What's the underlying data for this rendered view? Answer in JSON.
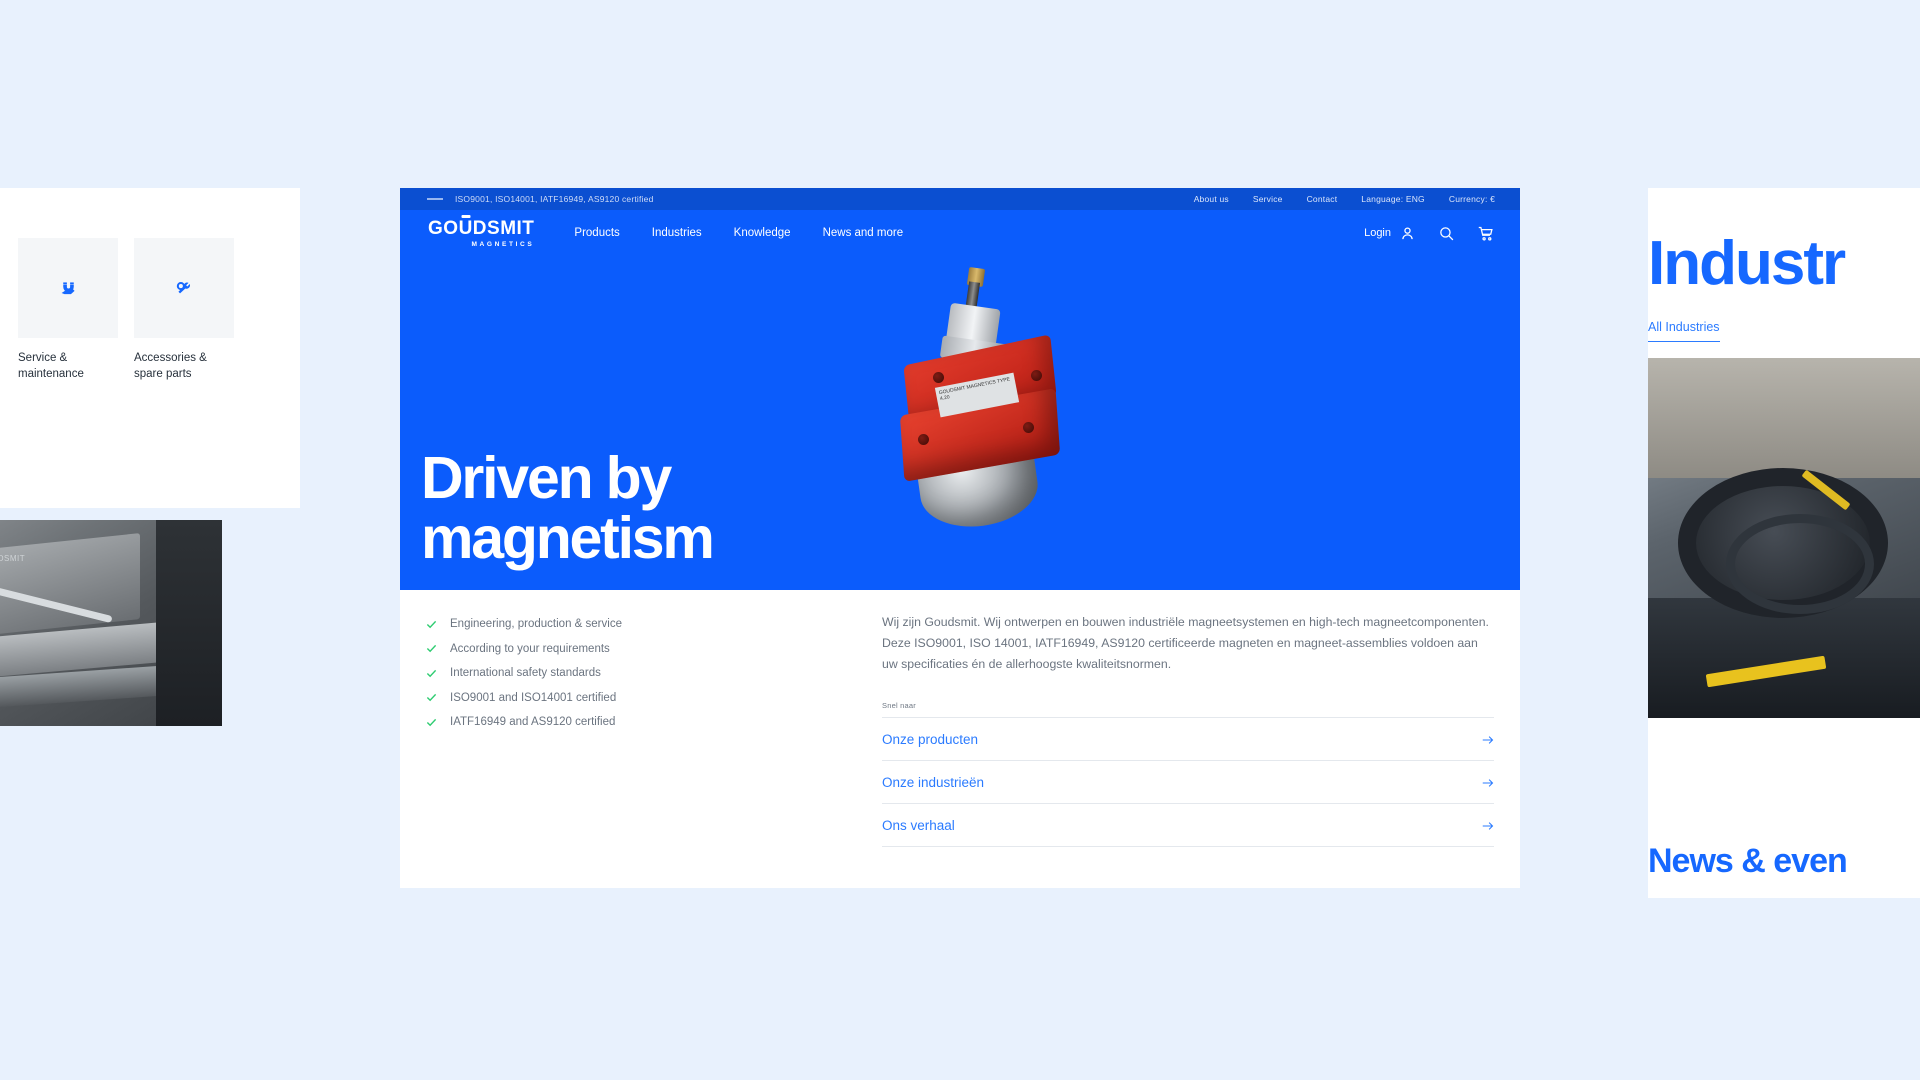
{
  "page": {
    "background_color": "#e8f1fd",
    "brand_blue": "#0b5cfc",
    "accent_blue": "#2b7bff",
    "dark_blue": "#0b4fd1",
    "green": "#2ecc71"
  },
  "left_panel": {
    "tiles": [
      {
        "label": "Service & maintenance",
        "icon": "magnet-on-hand-icon"
      },
      {
        "label": "Accessories & spare parts",
        "icon": "wrench-icon"
      }
    ],
    "photo_caption": "GOUDSMIT"
  },
  "right_panel": {
    "section_title": "Industr",
    "all_link": "All Industries",
    "news_title": "News & even"
  },
  "card": {
    "utility_bar": {
      "certification": "ISO9001,  ISO14001, IATF16949, AS9120 certified",
      "links": [
        {
          "label": "About us"
        },
        {
          "label": "Service"
        },
        {
          "label": "Contact"
        },
        {
          "label": "Language: ENG"
        },
        {
          "label": "Currency: €"
        }
      ]
    },
    "nav": {
      "logo_part1": "GO",
      "logo_part2": "U",
      "logo_part3": "DSMIT",
      "logo_sub": "MAGNETICS",
      "links": [
        {
          "label": "Products"
        },
        {
          "label": "Industries"
        },
        {
          "label": "Knowledge"
        },
        {
          "label": "News and more"
        }
      ],
      "login_label": "Login",
      "icons": [
        "user-icon",
        "search-icon",
        "cart-icon"
      ]
    },
    "hero": {
      "heading_line1": "Driven by",
      "heading_line2": "magnetism",
      "product_label": "GOUDSMIT\nMAGNETICS\nTYPE 4.20"
    },
    "checklist": [
      {
        "label": "Engineering, production & service"
      },
      {
        "label": "According to your requirements"
      },
      {
        "label": "International safety standards"
      },
      {
        "label": "ISO9001 and ISO14001 certified"
      },
      {
        "label": "IATF16949 and AS9120 certified"
      }
    ],
    "intro_paragraph": "Wij zijn Goudsmit. Wij ontwerpen en bouwen industriële magneetsystemen en high-tech magneetcomponenten. Deze ISO9001, ISO 14001, IATF16949, AS9120 certificeerde magneten en magneet-assemblies voldoen aan uw specificaties én de allerhoogste kwaliteitsnormen.",
    "quick_links_title": "Snel naar",
    "quick_links": [
      {
        "label": "Onze producten"
      },
      {
        "label": "Onze industrieën"
      },
      {
        "label": "Ons verhaal"
      }
    ]
  }
}
